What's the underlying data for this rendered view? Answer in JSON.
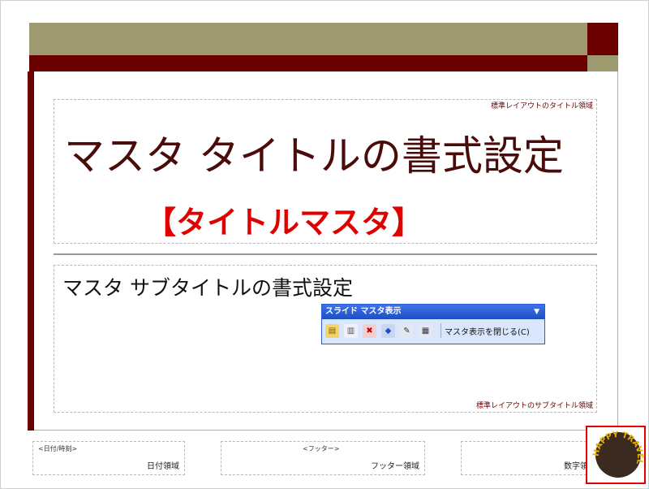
{
  "colors": {
    "olive": "#9c9a6e",
    "dark_red": "#6b0000",
    "title_red": "#e00000",
    "toolbar_blue": "#2a5bd6"
  },
  "title_placeholder": {
    "label": "標準レイアウトのタイトル領域",
    "text": "マスタ タイトルの書式設定",
    "tag": "【タイトルマスタ】"
  },
  "subtitle_placeholder": {
    "label": "標準レイアウトのサブタイトル領域",
    "text": "マスタ サブタイトルの書式設定"
  },
  "toolbar": {
    "title": "スライド マスタ表示",
    "close_label": "マスタ表示を閉じる(C)",
    "icons": [
      "new-slide-master-icon",
      "new-title-master-icon",
      "delete-master-icon",
      "preserve-master-icon",
      "rename-master-icon",
      "master-layout-icon"
    ]
  },
  "footer": {
    "date": {
      "tag": "<日付/時刻>",
      "label": "日付領域"
    },
    "footer": {
      "tag": "<フッター>",
      "label": "フッター領域"
    },
    "number": {
      "label": "数字領域"
    }
  },
  "badge": {
    "text": "HAPPY TRAVEL"
  }
}
